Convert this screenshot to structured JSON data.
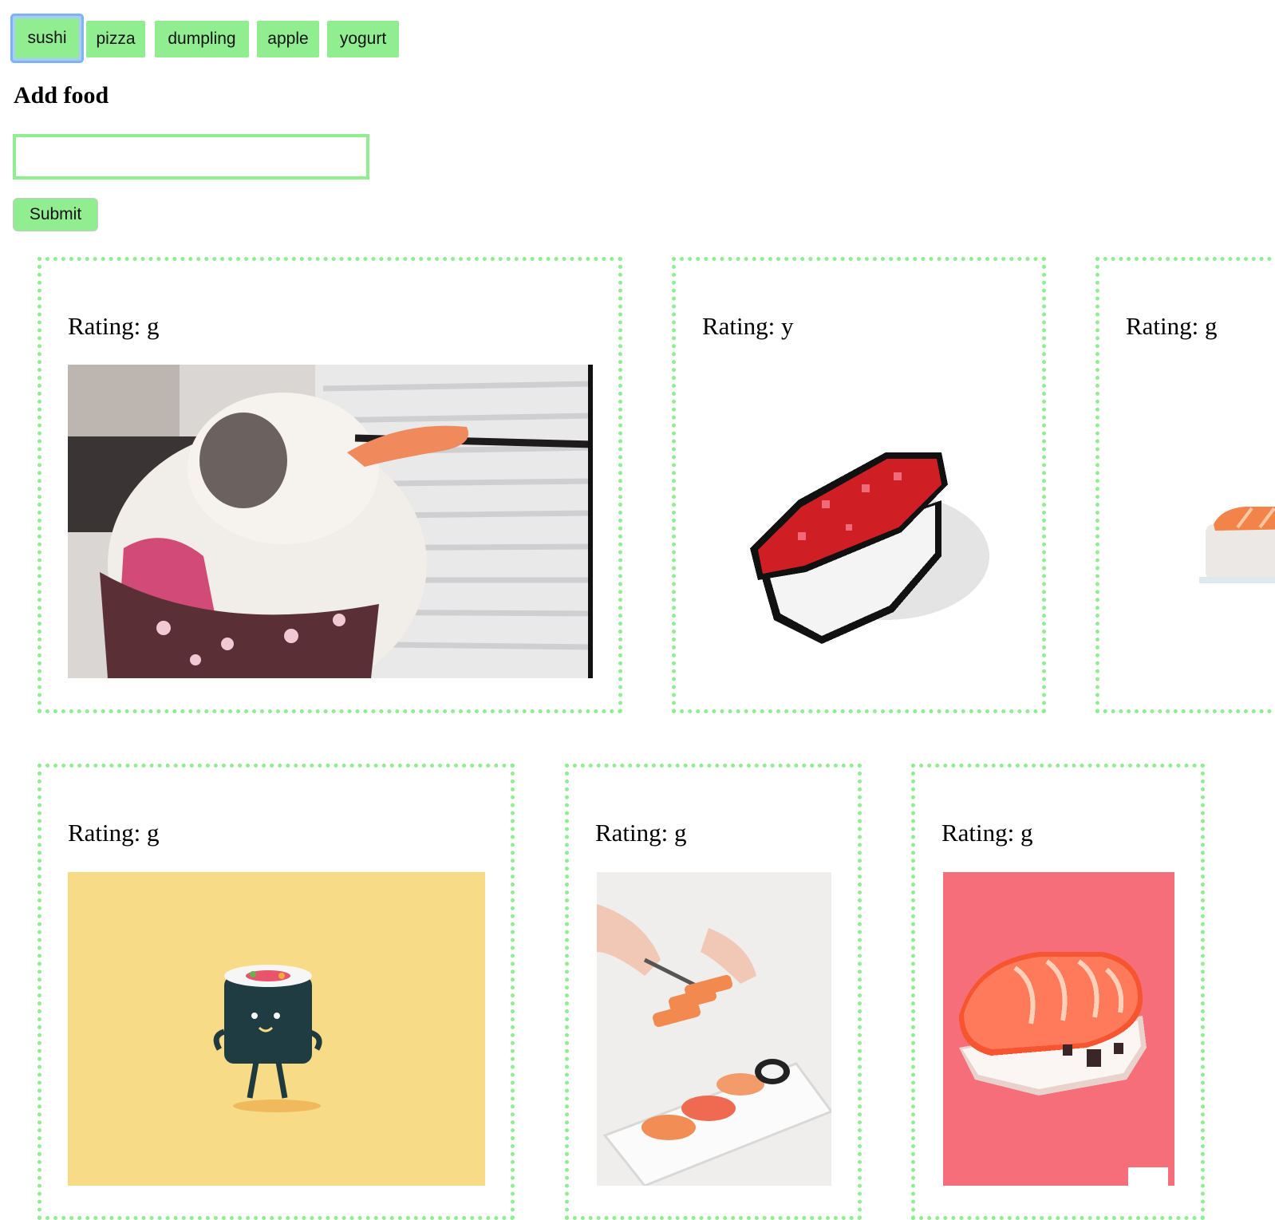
{
  "categories": [
    {
      "label": "sushi",
      "selected": true
    },
    {
      "label": "pizza"
    },
    {
      "label": "dumpling"
    },
    {
      "label": "apple"
    },
    {
      "label": "yogurt"
    }
  ],
  "form": {
    "heading": "Add food",
    "input_value": "",
    "submit_label": "Submit"
  },
  "cards": [
    {
      "rating": "Rating: g",
      "image": "cat-eating-sushi-gif"
    },
    {
      "rating": "Rating: y",
      "image": "pixel-tuna-nigiri-gif"
    },
    {
      "rating": "Rating: g",
      "image": "salmon-sushi-gif"
    },
    {
      "rating": "Rating: g",
      "image": "dancing-maki-roll-gif"
    },
    {
      "rating": "Rating: g",
      "image": "chef-slicing-sushi-gif"
    },
    {
      "rating": "Rating: g",
      "image": "pixel-salmon-nigiri-gif"
    }
  ],
  "colors": {
    "accent": "#90ee90",
    "focus_ring": "#7cb3ff"
  }
}
